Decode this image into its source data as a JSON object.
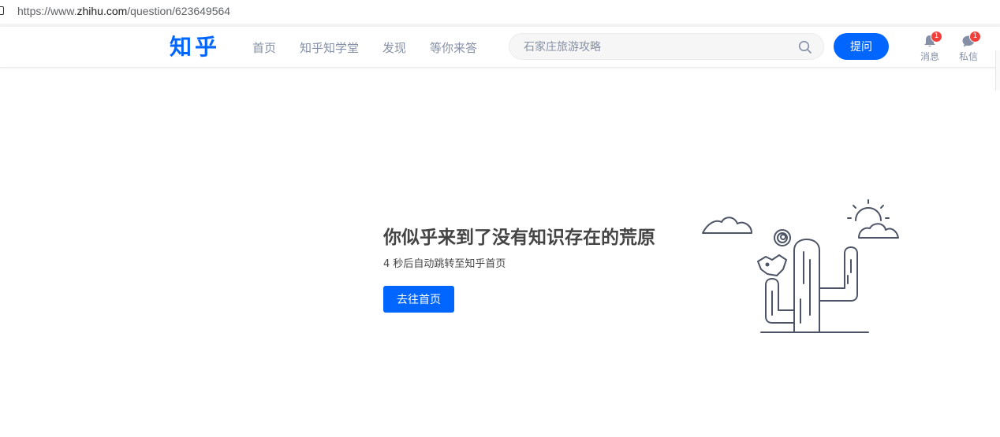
{
  "browser": {
    "url_prefix": "https://www.",
    "url_host": "zhihu.com",
    "url_path": "/question/623649564"
  },
  "header": {
    "logo": "知乎",
    "nav": [
      "首页",
      "知乎知学堂",
      "发现",
      "等你来答"
    ],
    "search_placeholder": "石家庄旅游攻略",
    "ask_label": "提问",
    "messages_label": "消息",
    "messages_badge": "1",
    "dm_label": "私信",
    "dm_badge": "1"
  },
  "error": {
    "title": "你似乎来到了没有知识存在的荒原",
    "subtitle": "4 秒后自动跳转至知乎首页",
    "button_label": "去往首页"
  },
  "colors": {
    "brand": "#0066ff",
    "nav_text": "#8590a6",
    "badge": "#f1403c",
    "illustration_stroke": "#4d5466"
  }
}
